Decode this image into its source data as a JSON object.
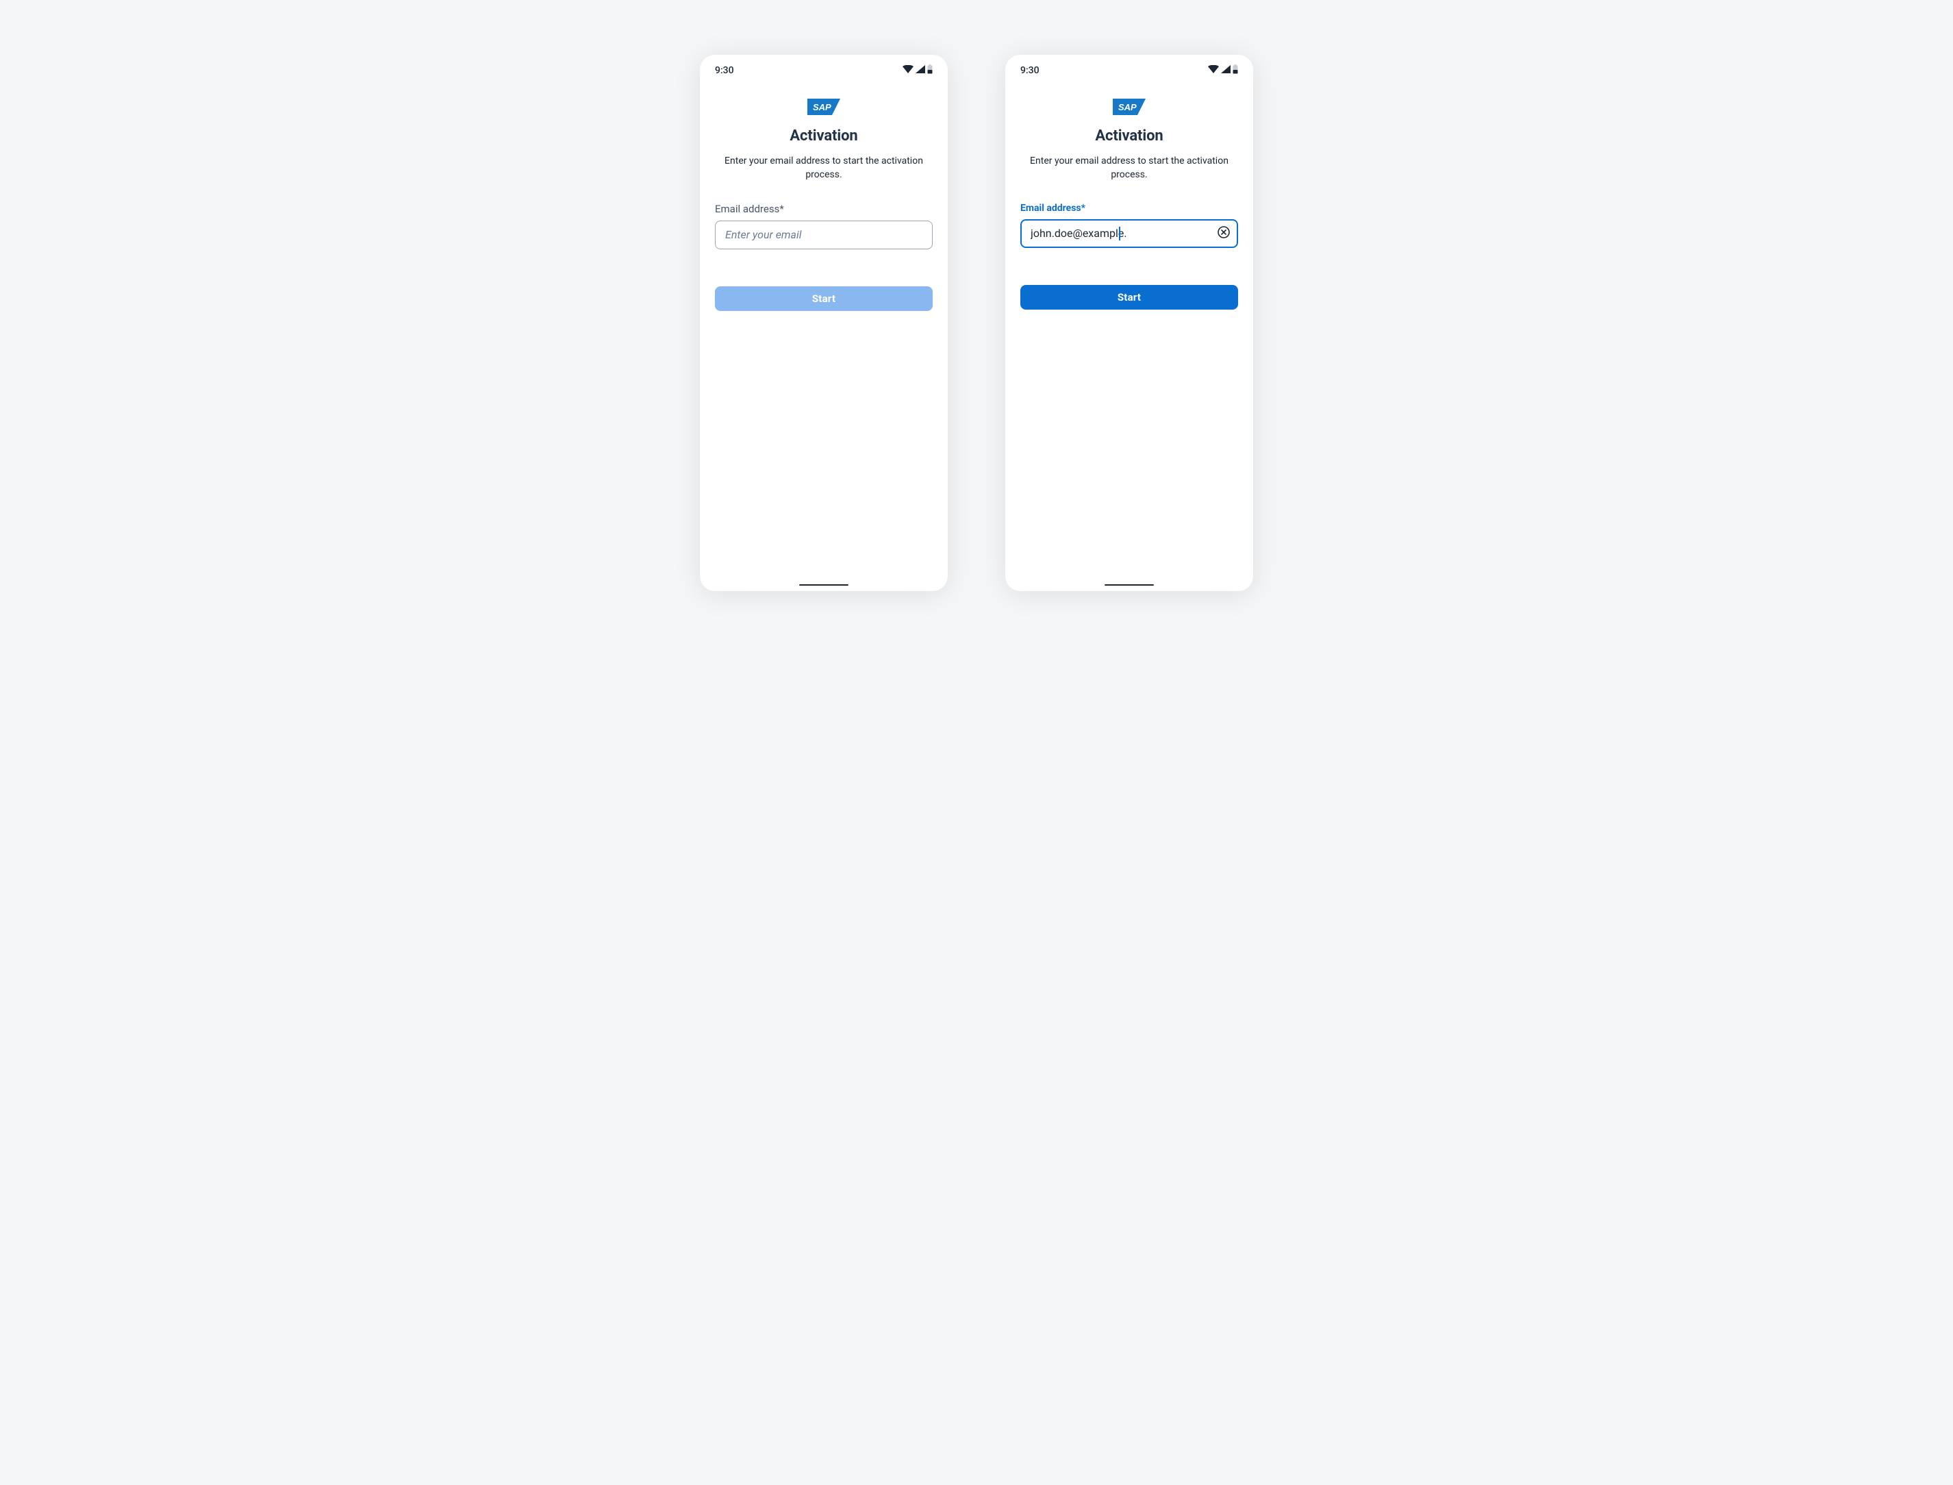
{
  "status": {
    "time": "9:30"
  },
  "logo": {
    "text": "SAP"
  },
  "page": {
    "title": "Activation",
    "description": "Enter your email address to start the activation process."
  },
  "form": {
    "email_label": "Email address*",
    "email_placeholder": "Enter your email",
    "email_value_empty": "",
    "email_value_filled": "john.doe@example.",
    "start_label": "Start"
  }
}
